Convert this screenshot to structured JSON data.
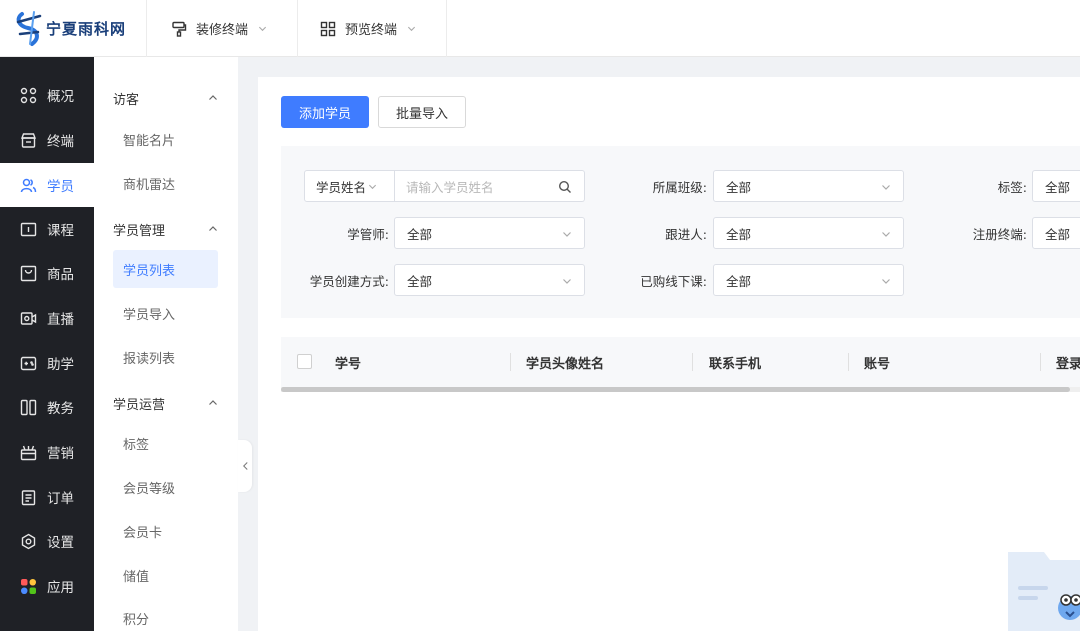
{
  "header": {
    "logo_text": "宁夏雨科网",
    "menus": [
      {
        "label": "装修终端",
        "icon": "paint-roller-icon"
      },
      {
        "label": "预览终端",
        "icon": "qr-grid-icon"
      }
    ]
  },
  "sidebar": {
    "items": [
      {
        "label": "概况",
        "icon": "grid-icon"
      },
      {
        "label": "终端",
        "icon": "store-icon"
      },
      {
        "label": "学员",
        "icon": "users-icon",
        "active": true
      },
      {
        "label": "课程",
        "icon": "book-icon"
      },
      {
        "label": "商品",
        "icon": "bag-icon"
      },
      {
        "label": "直播",
        "icon": "camera-icon"
      },
      {
        "label": "助学",
        "icon": "gamepad-icon"
      },
      {
        "label": "教务",
        "icon": "columns-icon"
      },
      {
        "label": "营销",
        "icon": "gift-icon"
      },
      {
        "label": "订单",
        "icon": "clipboard-icon"
      },
      {
        "label": "设置",
        "icon": "gear-icon"
      },
      {
        "label": "应用",
        "icon": "apps-icon"
      }
    ]
  },
  "subnav": {
    "groups": [
      {
        "label": "访客",
        "items": [
          "智能名片",
          "商机雷达"
        ]
      },
      {
        "label": "学员管理",
        "items": [
          "学员列表",
          "学员导入",
          "报读列表"
        ]
      },
      {
        "label": "学员运营",
        "items": [
          "标签",
          "会员等级",
          "会员卡",
          "储值",
          "积分"
        ]
      }
    ],
    "active_item": "学员列表"
  },
  "actions": {
    "add_label": "添加学员",
    "import_label": "批量导入"
  },
  "filters": {
    "search_prefix": "学员姓名",
    "search_placeholder": "请输入学员姓名",
    "class_label": "所属班级:",
    "class_value": "全部",
    "tag_label": "标签:",
    "tag_value": "全部",
    "manager_label": "学管师:",
    "manager_value": "全部",
    "follower_label": "跟进人:",
    "follower_value": "全部",
    "terminal_label": "注册终端:",
    "terminal_value": "全部",
    "create_label": "学员创建方式:",
    "create_value": "全部",
    "offline_label": "已购线下课:",
    "offline_value": "全部"
  },
  "table": {
    "columns": [
      "学号",
      "学员头像姓名",
      "联系手机",
      "账号",
      "登录"
    ]
  },
  "colors": {
    "accent": "#3f7cff",
    "sidebar_bg": "#1f2126"
  }
}
